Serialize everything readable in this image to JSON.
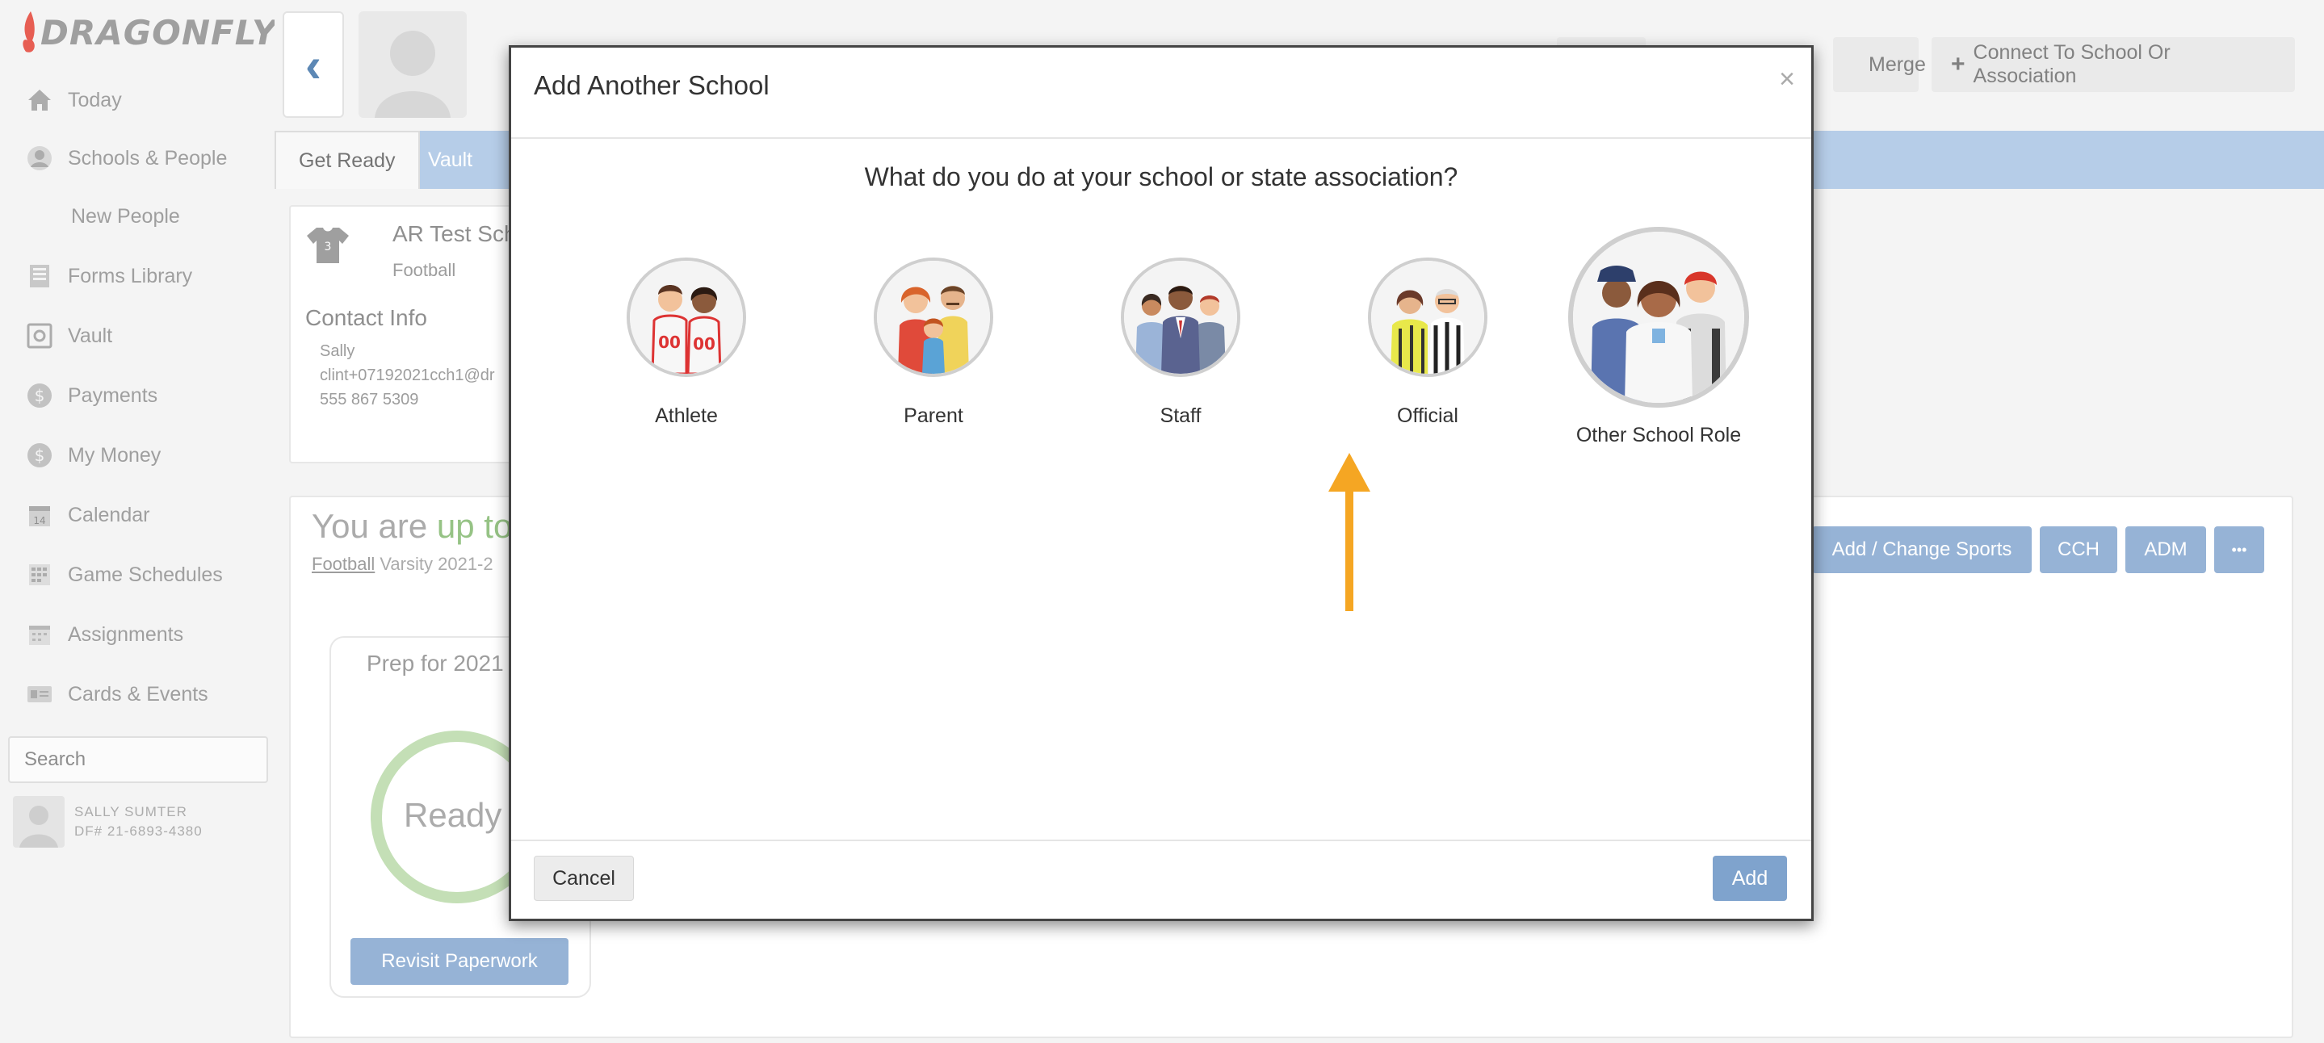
{
  "app": {
    "logo_text": "DRAGONFLY",
    "accent_color": "#7fa3cd",
    "tab_bar_color": "#a6c3e3",
    "arrow_color": "#f5a623"
  },
  "sidebar": {
    "items": [
      {
        "label": "Today",
        "icon": "home-icon"
      },
      {
        "label": "Schools & People",
        "icon": "person-icon"
      },
      {
        "label": "New People",
        "icon": ""
      },
      {
        "label": "Forms Library",
        "icon": "book-icon"
      },
      {
        "label": "Vault",
        "icon": "vault-icon"
      },
      {
        "label": "Payments",
        "icon": "dollar-icon"
      },
      {
        "label": "My Money",
        "icon": "dollar-icon"
      },
      {
        "label": "Calendar",
        "icon": "calendar-icon"
      },
      {
        "label": "Game Schedules",
        "icon": "schedule-icon"
      },
      {
        "label": "Assignments",
        "icon": "assignments-icon"
      },
      {
        "label": "Cards & Events",
        "icon": "card-icon"
      }
    ],
    "search_placeholder": "Search",
    "user": {
      "name": "SALLY SUMTER",
      "id": "DF# 21-6893-4380"
    }
  },
  "header": {
    "merge_label": "Merge",
    "connect_label": "Connect To School Or Association",
    "tabs": [
      {
        "label": "Get Ready"
      },
      {
        "label": "Vault"
      }
    ]
  },
  "school_card": {
    "name": "AR Test Scho",
    "jersey_number": "3",
    "sport": "Football",
    "contact_title": "Contact Info",
    "contact_name": "Sally",
    "contact_email": "clint+07192021cch1@dr",
    "contact_phone": "555 867 5309"
  },
  "status": {
    "prefix": "You are ",
    "highlight": "up to",
    "sport_link": "Football",
    "season": " Varsity 2021-2",
    "buttons": {
      "change_sports": "Add / Change Sports",
      "cch": "CCH",
      "adm": "ADM",
      "more": "•••"
    },
    "prep_title": "Prep for 2021",
    "ready_text": "Ready",
    "revisit_label": "Revisit Paperwork"
  },
  "modal": {
    "title": "Add Another School",
    "close": "×",
    "question": "What do you do at your school or state association?",
    "roles": [
      {
        "label": "Athlete"
      },
      {
        "label": "Parent"
      },
      {
        "label": "Staff"
      },
      {
        "label": "Official"
      },
      {
        "label": "Other School Role",
        "highlighted": true
      }
    ],
    "cancel_label": "Cancel",
    "add_label": "Add"
  }
}
